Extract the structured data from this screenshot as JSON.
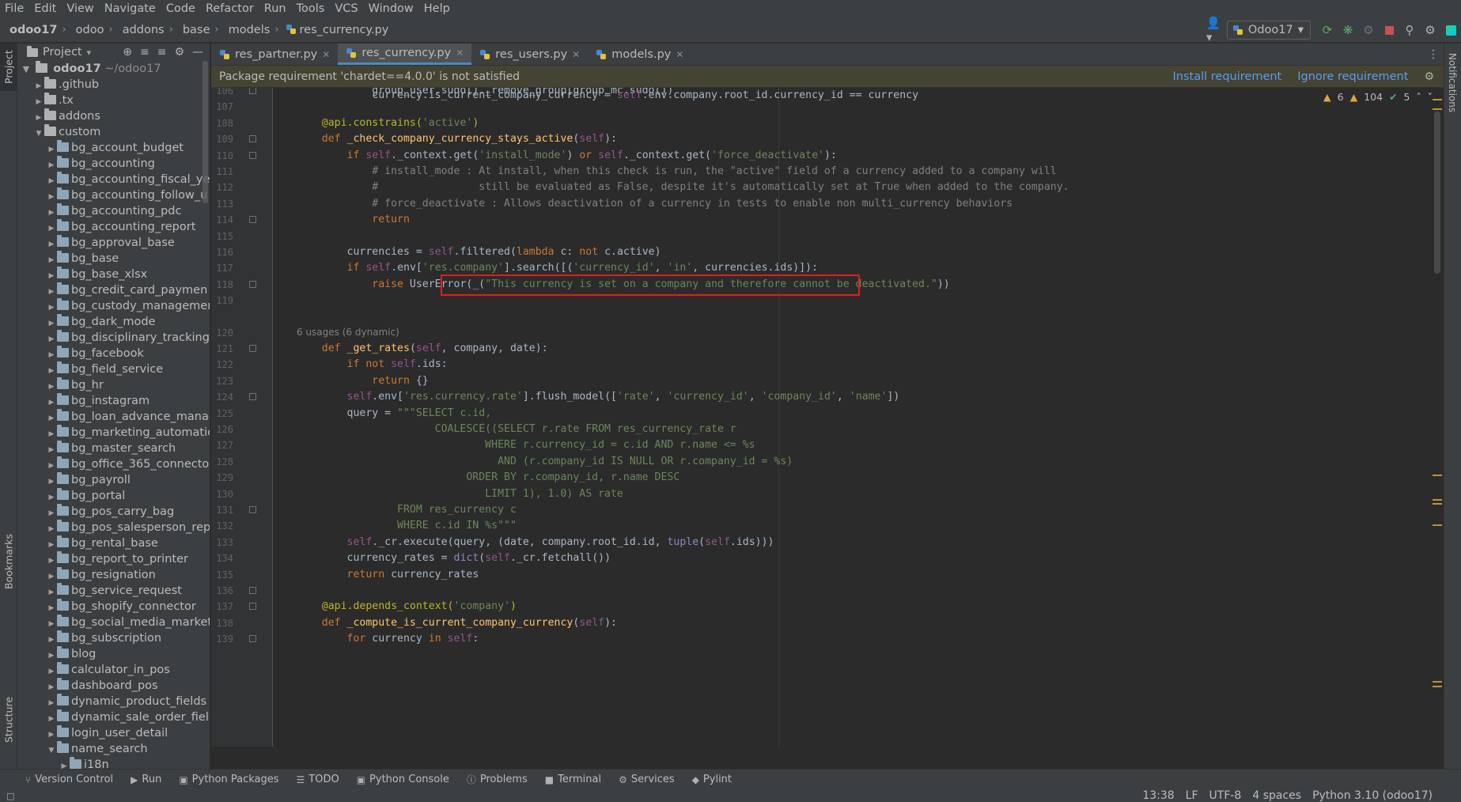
{
  "menu": [
    "File",
    "Edit",
    "View",
    "Navigate",
    "Code",
    "Refactor",
    "Run",
    "Tools",
    "VCS",
    "Window",
    "Help"
  ],
  "breadcrumb": [
    "odoo17",
    "odoo",
    "addons",
    "base",
    "models",
    "res_currency.py"
  ],
  "run_config": "Odoo17",
  "left_strip": {
    "project": "Project",
    "bookmarks": "Bookmarks",
    "structure": "Structure"
  },
  "right_strip": {
    "notifications": "Notifications"
  },
  "project_panel": {
    "title": "Project",
    "root": {
      "name": "odoo17",
      "path": "~/odoo17"
    },
    "items": [
      {
        "name": ".github",
        "depth": 1,
        "expanded": false
      },
      {
        "name": ".tx",
        "depth": 1,
        "expanded": false
      },
      {
        "name": "addons",
        "depth": 1,
        "expanded": false
      },
      {
        "name": "custom",
        "depth": 1,
        "expanded": true
      },
      {
        "name": "bg_account_budget",
        "depth": 2,
        "expanded": false
      },
      {
        "name": "bg_accounting",
        "depth": 2,
        "expanded": false
      },
      {
        "name": "bg_accounting_fiscal_ye",
        "depth": 2,
        "expanded": false
      },
      {
        "name": "bg_accounting_follow_u",
        "depth": 2,
        "expanded": false
      },
      {
        "name": "bg_accounting_pdc",
        "depth": 2,
        "expanded": false
      },
      {
        "name": "bg_accounting_report",
        "depth": 2,
        "expanded": false
      },
      {
        "name": "bg_approval_base",
        "depth": 2,
        "expanded": false
      },
      {
        "name": "bg_base",
        "depth": 2,
        "expanded": false
      },
      {
        "name": "bg_base_xlsx",
        "depth": 2,
        "expanded": false
      },
      {
        "name": "bg_credit_card_paymen",
        "depth": 2,
        "expanded": false
      },
      {
        "name": "bg_custody_managemen",
        "depth": 2,
        "expanded": false
      },
      {
        "name": "bg_dark_mode",
        "depth": 2,
        "expanded": false
      },
      {
        "name": "bg_disciplinary_tracking",
        "depth": 2,
        "expanded": false
      },
      {
        "name": "bg_facebook",
        "depth": 2,
        "expanded": false
      },
      {
        "name": "bg_field_service",
        "depth": 2,
        "expanded": false
      },
      {
        "name": "bg_hr",
        "depth": 2,
        "expanded": false
      },
      {
        "name": "bg_instagram",
        "depth": 2,
        "expanded": false
      },
      {
        "name": "bg_loan_advance_manag",
        "depth": 2,
        "expanded": false
      },
      {
        "name": "bg_marketing_automatic",
        "depth": 2,
        "expanded": false
      },
      {
        "name": "bg_master_search",
        "depth": 2,
        "expanded": false
      },
      {
        "name": "bg_office_365_connecto",
        "depth": 2,
        "expanded": false
      },
      {
        "name": "bg_payroll",
        "depth": 2,
        "expanded": false
      },
      {
        "name": "bg_portal",
        "depth": 2,
        "expanded": false
      },
      {
        "name": "bg_pos_carry_bag",
        "depth": 2,
        "expanded": false
      },
      {
        "name": "bg_pos_salesperson_rep",
        "depth": 2,
        "expanded": false
      },
      {
        "name": "bg_rental_base",
        "depth": 2,
        "expanded": false
      },
      {
        "name": "bg_report_to_printer",
        "depth": 2,
        "expanded": false
      },
      {
        "name": "bg_resignation",
        "depth": 2,
        "expanded": false
      },
      {
        "name": "bg_service_request",
        "depth": 2,
        "expanded": false
      },
      {
        "name": "bg_shopify_connector",
        "depth": 2,
        "expanded": false
      },
      {
        "name": "bg_social_media_market",
        "depth": 2,
        "expanded": false
      },
      {
        "name": "bg_subscription",
        "depth": 2,
        "expanded": false
      },
      {
        "name": "blog",
        "depth": 2,
        "expanded": false
      },
      {
        "name": "calculator_in_pos",
        "depth": 2,
        "expanded": false
      },
      {
        "name": "dashboard_pos",
        "depth": 2,
        "expanded": false
      },
      {
        "name": "dynamic_product_fields",
        "depth": 2,
        "expanded": false
      },
      {
        "name": "dynamic_sale_order_fiel",
        "depth": 2,
        "expanded": false
      },
      {
        "name": "login_user_detail",
        "depth": 2,
        "expanded": false
      },
      {
        "name": "name_search",
        "depth": 2,
        "expanded": true
      },
      {
        "name": "i18n",
        "depth": 3,
        "expanded": false
      }
    ]
  },
  "tabs": [
    {
      "label": "res_partner.py",
      "active": false
    },
    {
      "label": "res_currency.py",
      "active": true
    },
    {
      "label": "res_users.py",
      "active": false
    },
    {
      "label": "models.py",
      "active": false
    }
  ],
  "banner": {
    "message": "Package requirement 'chardet==4.0.0' is not satisfied",
    "install": "Install requirement",
    "ignore": "Ignore requirement"
  },
  "inspections": {
    "warnings": "6",
    "weak_warnings": "104",
    "ok": "5"
  },
  "usages_hint": "6 usages (6 dynamic)",
  "line_numbers": [
    "106",
    "107",
    "108",
    "109",
    "110",
    "111",
    "112",
    "113",
    "114",
    "115",
    "116",
    "117",
    "118",
    "119",
    "120",
    "121",
    "122",
    "123",
    "124",
    "125",
    "126",
    "127",
    "128",
    "129",
    "130",
    "131",
    "132",
    "133",
    "134",
    "135",
    "136",
    "137",
    "138",
    "139"
  ],
  "code": [
    [
      {
        "t": "            group_user.sudo()._remove_group(group_mc.sudo())",
        "c": ""
      }
    ],
    [],
    [
      {
        "t": "    ",
        "c": ""
      },
      {
        "t": "@api.constrains(",
        "c": "dec"
      },
      {
        "t": "'active'",
        "c": "str"
      },
      {
        "t": ")",
        "c": "dec"
      }
    ],
    [
      {
        "t": "    ",
        "c": ""
      },
      {
        "t": "def ",
        "c": "kw"
      },
      {
        "t": "_check_company_currency_stays_active",
        "c": "fn"
      },
      {
        "t": "(",
        "c": ""
      },
      {
        "t": "self",
        "c": "slf"
      },
      {
        "t": "):",
        "c": ""
      }
    ],
    [
      {
        "t": "        ",
        "c": ""
      },
      {
        "t": "if ",
        "c": "kw"
      },
      {
        "t": "self",
        "c": "slf"
      },
      {
        "t": "._context.get(",
        "c": ""
      },
      {
        "t": "'install_mode'",
        "c": "str"
      },
      {
        "t": ") ",
        "c": ""
      },
      {
        "t": "or ",
        "c": "kw"
      },
      {
        "t": "self",
        "c": "slf"
      },
      {
        "t": "._context.get(",
        "c": ""
      },
      {
        "t": "'force_deactivate'",
        "c": "str"
      },
      {
        "t": "):",
        "c": ""
      }
    ],
    [
      {
        "t": "            ",
        "c": ""
      },
      {
        "t": "# install_mode : At install, when this check is run, the \"active\" field of a currency added to a company will",
        "c": "cmt"
      }
    ],
    [
      {
        "t": "            ",
        "c": ""
      },
      {
        "t": "#                still be evaluated as False, despite it's automatically set at True when added to the company.",
        "c": "cmt"
      }
    ],
    [
      {
        "t": "            ",
        "c": ""
      },
      {
        "t": "# force_deactivate : Allows deactivation of a currency in tests to enable non multi_currency behaviors",
        "c": "cmt"
      }
    ],
    [
      {
        "t": "            ",
        "c": ""
      },
      {
        "t": "return",
        "c": "kw"
      }
    ],
    [],
    [
      {
        "t": "        currencies = ",
        "c": ""
      },
      {
        "t": "self",
        "c": "slf"
      },
      {
        "t": ".filtered(",
        "c": ""
      },
      {
        "t": "lambda ",
        "c": "kw"
      },
      {
        "t": "c: ",
        "c": ""
      },
      {
        "t": "not ",
        "c": "kw"
      },
      {
        "t": "c.active)",
        "c": ""
      }
    ],
    [
      {
        "t": "        ",
        "c": ""
      },
      {
        "t": "if ",
        "c": "kw"
      },
      {
        "t": "self",
        "c": "slf"
      },
      {
        "t": ".env[",
        "c": ""
      },
      {
        "t": "'res.company'",
        "c": "str"
      },
      {
        "t": "].search([(",
        "c": ""
      },
      {
        "t": "'currency_id'",
        "c": "str"
      },
      {
        "t": ", ",
        "c": ""
      },
      {
        "t": "'in'",
        "c": "str"
      },
      {
        "t": ", currencies.ids)]):",
        "c": ""
      }
    ],
    [
      {
        "t": "            ",
        "c": ""
      },
      {
        "t": "raise ",
        "c": "kw"
      },
      {
        "t": "UserError(_(",
        "c": ""
      },
      {
        "t": "\"This currency is set on a company and therefore cannot be deactivated.\"",
        "c": "str"
      },
      {
        "t": "))",
        "c": ""
      }
    ],
    [],
    [],
    [
      {
        "t": "    ",
        "c": ""
      },
      {
        "t": "def ",
        "c": "kw"
      },
      {
        "t": "_get_rates",
        "c": "fn"
      },
      {
        "t": "(",
        "c": ""
      },
      {
        "t": "self",
        "c": "slf"
      },
      {
        "t": ", company, date):",
        "c": ""
      }
    ],
    [
      {
        "t": "        ",
        "c": ""
      },
      {
        "t": "if not ",
        "c": "kw"
      },
      {
        "t": "self",
        "c": "slf"
      },
      {
        "t": ".ids:",
        "c": ""
      }
    ],
    [
      {
        "t": "            ",
        "c": ""
      },
      {
        "t": "return ",
        "c": "kw"
      },
      {
        "t": "{}",
        "c": ""
      }
    ],
    [
      {
        "t": "        ",
        "c": ""
      },
      {
        "t": "self",
        "c": "slf"
      },
      {
        "t": ".env[",
        "c": ""
      },
      {
        "t": "'res.currency.rate'",
        "c": "str"
      },
      {
        "t": "].flush_model([",
        "c": ""
      },
      {
        "t": "'rate'",
        "c": "str"
      },
      {
        "t": ", ",
        "c": ""
      },
      {
        "t": "'currency_id'",
        "c": "str"
      },
      {
        "t": ", ",
        "c": ""
      },
      {
        "t": "'company_id'",
        "c": "str"
      },
      {
        "t": ", ",
        "c": ""
      },
      {
        "t": "'name'",
        "c": "str"
      },
      {
        "t": "])",
        "c": ""
      }
    ],
    [
      {
        "t": "        query = ",
        "c": ""
      },
      {
        "t": "\"\"\"SELECT c.id,",
        "c": "str"
      }
    ],
    [
      {
        "t": "                      COALESCE((SELECT r.rate FROM res_currency_rate r",
        "c": "str"
      }
    ],
    [
      {
        "t": "                              WHERE r.currency_id = c.id AND r.name <= %s",
        "c": "str"
      }
    ],
    [
      {
        "t": "                                AND (r.company_id IS NULL OR r.company_id = %s)",
        "c": "str"
      }
    ],
    [
      {
        "t": "                           ORDER BY r.company_id, r.name DESC",
        "c": "str"
      }
    ],
    [
      {
        "t": "                              LIMIT 1), 1.0) AS rate",
        "c": "str"
      }
    ],
    [
      {
        "t": "                FROM res_currency c",
        "c": "str"
      }
    ],
    [
      {
        "t": "                WHERE c.id IN %s\"\"\"",
        "c": "str"
      }
    ],
    [
      {
        "t": "        ",
        "c": ""
      },
      {
        "t": "self",
        "c": "slf"
      },
      {
        "t": "._cr.execute(query, (date, company.root_id.id, ",
        "c": ""
      },
      {
        "t": "tuple",
        "c": "bi"
      },
      {
        "t": "(",
        "c": ""
      },
      {
        "t": "self",
        "c": "slf"
      },
      {
        "t": ".ids)))",
        "c": ""
      }
    ],
    [
      {
        "t": "        currency_rates = ",
        "c": ""
      },
      {
        "t": "dict",
        "c": "bi"
      },
      {
        "t": "(",
        "c": ""
      },
      {
        "t": "self",
        "c": "slf"
      },
      {
        "t": "._cr.fetchall())",
        "c": ""
      }
    ],
    [
      {
        "t": "        ",
        "c": ""
      },
      {
        "t": "return ",
        "c": "kw"
      },
      {
        "t": "currency_rates",
        "c": ""
      }
    ],
    [],
    [
      {
        "t": "    ",
        "c": ""
      },
      {
        "t": "@api.depends_context(",
        "c": "dec"
      },
      {
        "t": "'company'",
        "c": "str"
      },
      {
        "t": ")",
        "c": "dec"
      }
    ],
    [
      {
        "t": "    ",
        "c": ""
      },
      {
        "t": "def ",
        "c": "kw"
      },
      {
        "t": "_compute_is_current_company_currency",
        "c": "fn"
      },
      {
        "t": "(",
        "c": ""
      },
      {
        "t": "self",
        "c": "slf"
      },
      {
        "t": "):",
        "c": ""
      }
    ],
    [
      {
        "t": "        ",
        "c": ""
      },
      {
        "t": "for ",
        "c": "kw"
      },
      {
        "t": "currency ",
        "c": ""
      },
      {
        "t": "in ",
        "c": "kw"
      },
      {
        "t": "self",
        "c": "slf"
      },
      {
        "t": ":",
        "c": ""
      }
    ],
    [
      {
        "t": "            currency.is_current_company_currency = ",
        "c": ""
      },
      {
        "t": "self",
        "c": "slf"
      },
      {
        "t": ".env.company.root_id.currency_id == currency",
        "c": ""
      }
    ]
  ],
  "bottom_tools": [
    {
      "label": "Version Control",
      "icon": "branch-icon"
    },
    {
      "label": "Run",
      "icon": "run-icon"
    },
    {
      "label": "Python Packages",
      "icon": "packages-icon"
    },
    {
      "label": "TODO",
      "icon": "todo-icon"
    },
    {
      "label": "Python Console",
      "icon": "console-icon"
    },
    {
      "label": "Problems",
      "icon": "problems-icon"
    },
    {
      "label": "Terminal",
      "icon": "terminal-icon"
    },
    {
      "label": "Services",
      "icon": "services-icon"
    },
    {
      "label": "Pylint",
      "icon": "pylint-icon"
    }
  ],
  "status": {
    "position": "13:38",
    "line_sep": "LF",
    "encoding": "UTF-8",
    "indent": "4 spaces",
    "interpreter": "Python 3.10 (odoo17)"
  }
}
